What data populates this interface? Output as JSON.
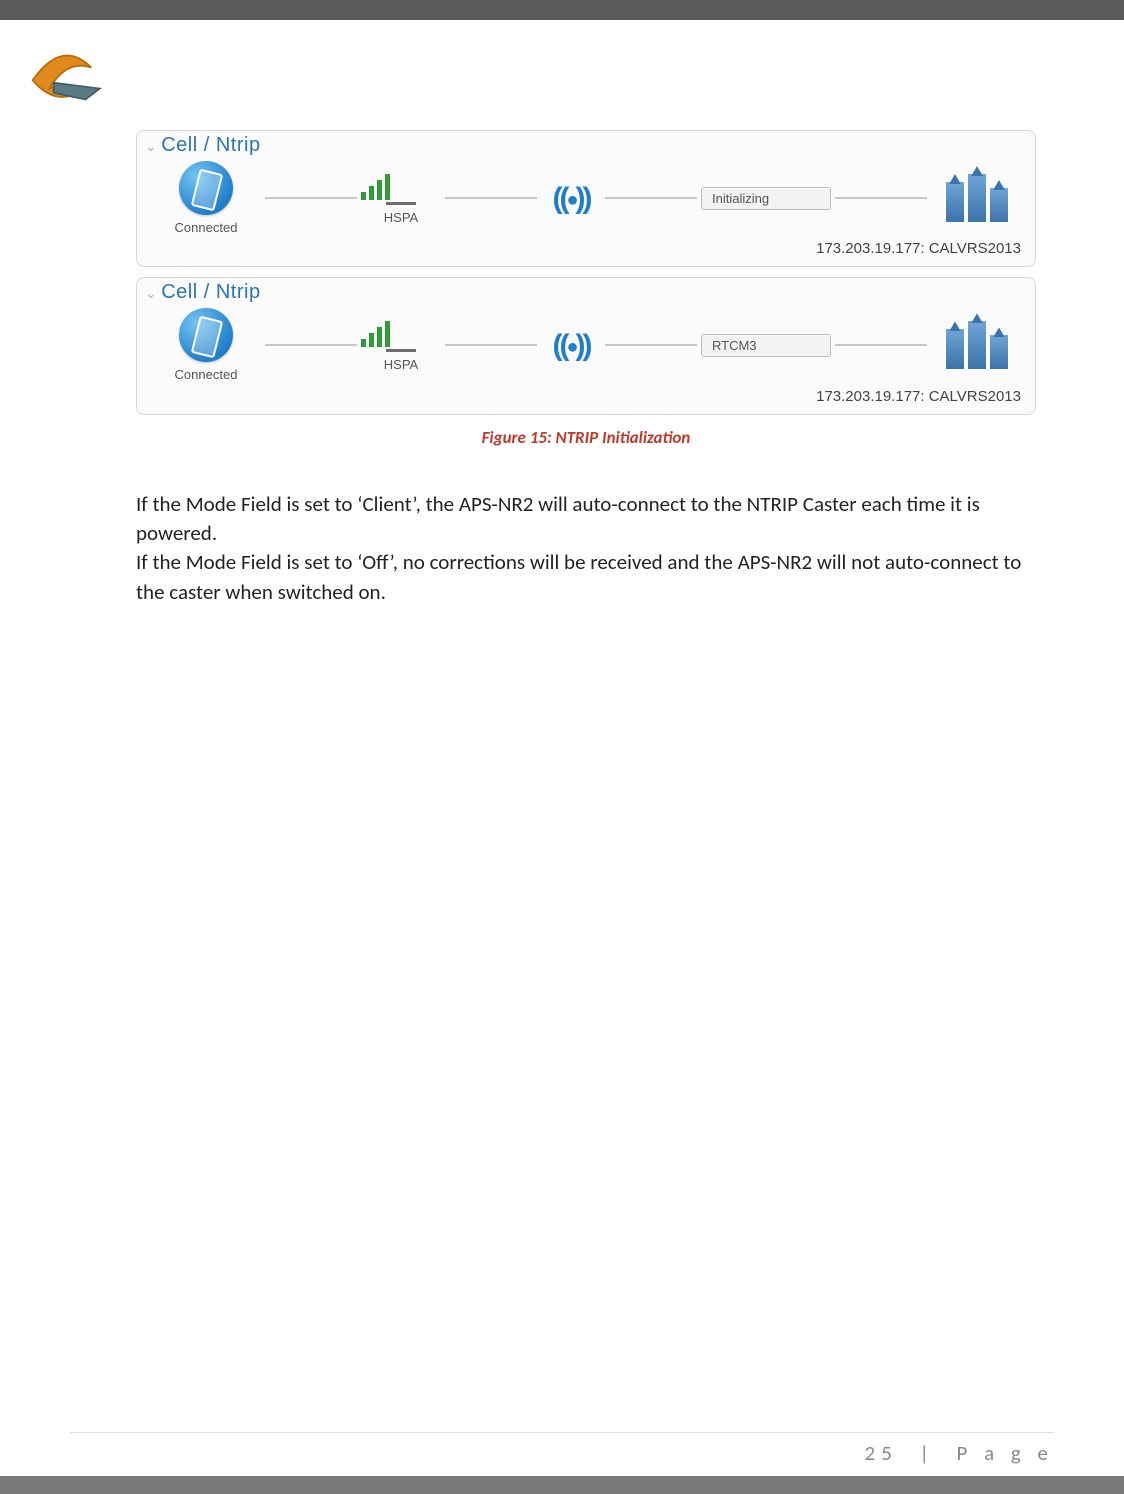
{
  "panels": [
    {
      "title": "Cell / Ntrip",
      "connected_label": "Connected",
      "network_label": "HSPA",
      "status_text": "Initializing",
      "address": "173.203.19.177: CALVRS2013"
    },
    {
      "title": "Cell / Ntrip",
      "connected_label": "Connected",
      "network_label": "HSPA",
      "status_text": "RTCM3",
      "address": "173.203.19.177: CALVRS2013"
    }
  ],
  "figure_caption": "Figure 15:  NTRIP Initialization",
  "body_para_1": "If the Mode Field is set to ‘Client’, the APS-NR2 will auto-connect to the NTRIP Caster each time it is powered.",
  "body_para_2": "If the Mode Field is set to ‘Off’, no corrections will be received and the APS-NR2 will not auto-connect to the caster when switched on.",
  "footer": {
    "page_number": "25",
    "page_label": "P a g e",
    "separator": "|"
  }
}
